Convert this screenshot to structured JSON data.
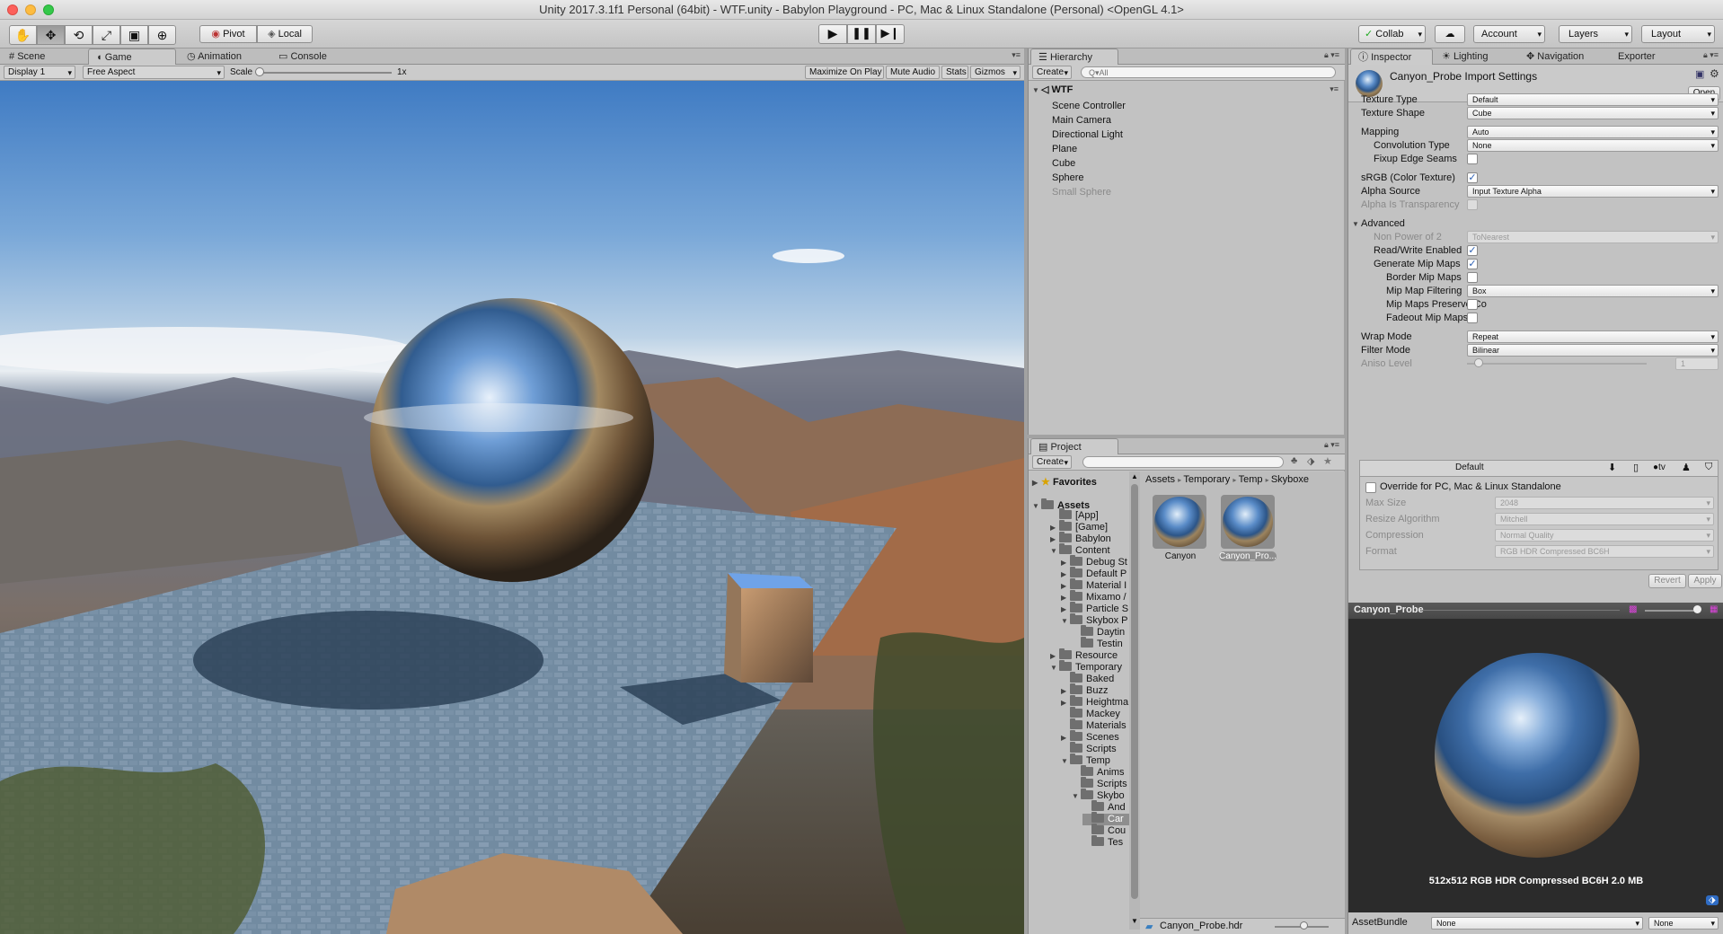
{
  "window": {
    "title": "Unity 2017.3.1f1 Personal (64bit) - WTF.unity - Babylon Playground - PC, Mac & Linux Standalone (Personal) <OpenGL 4.1>"
  },
  "toolbar": {
    "pivot": "Pivot",
    "local": "Local",
    "collab": "Collab",
    "account": "Account",
    "layers": "Layers",
    "layout": "Layout"
  },
  "game_tabs": [
    "Scene",
    "Game",
    "Animation",
    "Console"
  ],
  "game_bar": {
    "display": "Display 1",
    "aspect": "Free Aspect",
    "scale_label": "Scale",
    "scale_value": "1x",
    "maximize": "Maximize On Play",
    "mute": "Mute Audio",
    "stats": "Stats",
    "gizmos": "Gizmos"
  },
  "hierarchy": {
    "tab": "Hierarchy",
    "create": "Create",
    "search_placeholder": "Q▾All",
    "scene": "WTF",
    "items": [
      "Scene Controller",
      "Main Camera",
      "Directional Light",
      "Plane",
      "Cube",
      "Sphere",
      "Small Sphere"
    ]
  },
  "project": {
    "tab": "Project",
    "create": "Create",
    "favorites": "Favorites",
    "assets": "Assets",
    "tree": [
      {
        "label": "[App]",
        "indent": 1,
        "arrow": ""
      },
      {
        "label": "[Game]",
        "indent": 1,
        "arrow": "▶"
      },
      {
        "label": "Babylon",
        "indent": 1,
        "arrow": "▶"
      },
      {
        "label": "Content",
        "indent": 1,
        "arrow": "▼"
      },
      {
        "label": "Debug St",
        "indent": 2,
        "arrow": "▶"
      },
      {
        "label": "Default P",
        "indent": 2,
        "arrow": "▶"
      },
      {
        "label": "Material I",
        "indent": 2,
        "arrow": "▶"
      },
      {
        "label": "Mixamo /",
        "indent": 2,
        "arrow": "▶"
      },
      {
        "label": "Particle S",
        "indent": 2,
        "arrow": "▶"
      },
      {
        "label": "Skybox P",
        "indent": 2,
        "arrow": "▼"
      },
      {
        "label": "Daytin",
        "indent": 3,
        "arrow": ""
      },
      {
        "label": "Testin",
        "indent": 3,
        "arrow": ""
      },
      {
        "label": "Resource",
        "indent": 1,
        "arrow": "▶"
      },
      {
        "label": "Temporary",
        "indent": 1,
        "arrow": "▼"
      },
      {
        "label": "Baked",
        "indent": 2,
        "arrow": ""
      },
      {
        "label": "Buzz",
        "indent": 2,
        "arrow": "▶"
      },
      {
        "label": "Heightma",
        "indent": 2,
        "arrow": "▶"
      },
      {
        "label": "Mackey",
        "indent": 2,
        "arrow": ""
      },
      {
        "label": "Materials",
        "indent": 2,
        "arrow": ""
      },
      {
        "label": "Scenes",
        "indent": 2,
        "arrow": "▶"
      },
      {
        "label": "Scripts",
        "indent": 2,
        "arrow": ""
      },
      {
        "label": "Temp",
        "indent": 2,
        "arrow": "▼"
      },
      {
        "label": "Anims",
        "indent": 3,
        "arrow": ""
      },
      {
        "label": "Scripts",
        "indent": 3,
        "arrow": ""
      },
      {
        "label": "Skybo",
        "indent": 3,
        "arrow": "▼"
      },
      {
        "label": "And",
        "indent": 4,
        "arrow": ""
      },
      {
        "label": "Car",
        "indent": 4,
        "arrow": ""
      },
      {
        "label": "Cou",
        "indent": 4,
        "arrow": ""
      },
      {
        "label": "Tes",
        "indent": 4,
        "arrow": ""
      }
    ],
    "breadcrumb": [
      "Assets",
      "Temporary",
      "Temp",
      "Skyboxe"
    ],
    "thumbs": [
      "Canyon",
      "Canyon_Pro..."
    ],
    "selected_file": "Canyon_Probe.hdr"
  },
  "inspector": {
    "tabs": [
      "Inspector",
      "Lighting",
      "Navigation",
      "Exporter"
    ],
    "title": "Canyon_Probe Import Settings",
    "open": "Open",
    "rows": [
      {
        "label": "Texture Type",
        "value": "Default",
        "kind": "drop",
        "indent": 0
      },
      {
        "label": "Texture Shape",
        "value": "Cube",
        "kind": "drop",
        "indent": 0
      },
      {
        "label": "Mapping",
        "value": "Auto",
        "kind": "drop",
        "indent": 0
      },
      {
        "label": "Convolution Type",
        "value": "None",
        "kind": "drop",
        "indent": 1
      },
      {
        "label": "Fixup Edge Seams",
        "value": "",
        "kind": "check",
        "indent": 1
      },
      {
        "label": "sRGB (Color Texture)",
        "value": "✓",
        "kind": "check",
        "indent": 0
      },
      {
        "label": "Alpha Source",
        "value": "Input Texture Alpha",
        "kind": "drop",
        "indent": 0
      },
      {
        "label": "Alpha Is Transparency",
        "value": "",
        "kind": "checkdis",
        "indent": 0
      },
      {
        "label": "Advanced",
        "value": "",
        "kind": "fold",
        "indent": 0
      },
      {
        "label": "Non Power of 2",
        "value": "ToNearest",
        "kind": "dropdis",
        "indent": 1
      },
      {
        "label": "Read/Write Enabled",
        "value": "✓",
        "kind": "check",
        "indent": 1
      },
      {
        "label": "Generate Mip Maps",
        "value": "✓",
        "kind": "check",
        "indent": 1
      },
      {
        "label": "Border Mip Maps",
        "value": "",
        "kind": "check",
        "indent": 2
      },
      {
        "label": "Mip Map Filtering",
        "value": "Box",
        "kind": "drop",
        "indent": 2
      },
      {
        "label": "Mip Maps Preserve Co",
        "value": "",
        "kind": "check",
        "indent": 2
      },
      {
        "label": "Fadeout Mip Maps",
        "value": "",
        "kind": "check",
        "indent": 2
      },
      {
        "label": "Wrap Mode",
        "value": "Repeat",
        "kind": "drop",
        "indent": 0
      },
      {
        "label": "Filter Mode",
        "value": "Bilinear",
        "kind": "drop",
        "indent": 0
      },
      {
        "label": "Aniso Level",
        "value": "1",
        "kind": "slider",
        "indent": 0
      }
    ],
    "platform_default": "Default",
    "override": "Override for PC, Mac & Linux Standalone",
    "platform_rows": [
      {
        "label": "Max Size",
        "value": "2048"
      },
      {
        "label": "Resize Algorithm",
        "value": "Mitchell"
      },
      {
        "label": "Compression",
        "value": "Normal Quality"
      },
      {
        "label": "Format",
        "value": "RGB HDR Compressed BC6H"
      }
    ],
    "revert": "Revert",
    "apply": "Apply",
    "preview_title": "Canyon_Probe",
    "preview_info": "512x512  RGB HDR Compressed BC6H   2.0 MB",
    "assetbundle_label": "AssetBundle",
    "assetbundle_value": "None",
    "assetbundle_variant": "None"
  }
}
